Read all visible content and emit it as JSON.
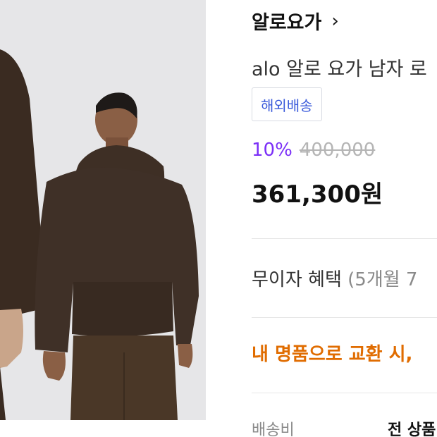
{
  "brand": {
    "name": "알로요가",
    "arrow": "›"
  },
  "product": {
    "name": "alo 알로 요가 남자 로"
  },
  "badge": {
    "label": "해외배송",
    "color": "#3b5bdb"
  },
  "price": {
    "discount_rate": "10%",
    "original": "400,000",
    "sale": "361,300원",
    "discount_color": "#7b2ff7"
  },
  "installment": {
    "label": "무이자 혜택",
    "detail": "(5개월 7"
  },
  "promo": {
    "text": "내 명품으로 교환 시, ",
    "color": "#e06c00"
  },
  "shipping": {
    "label": "배송비",
    "value": "전 상품"
  },
  "image": {
    "subject": "brown-hoodie-models"
  }
}
